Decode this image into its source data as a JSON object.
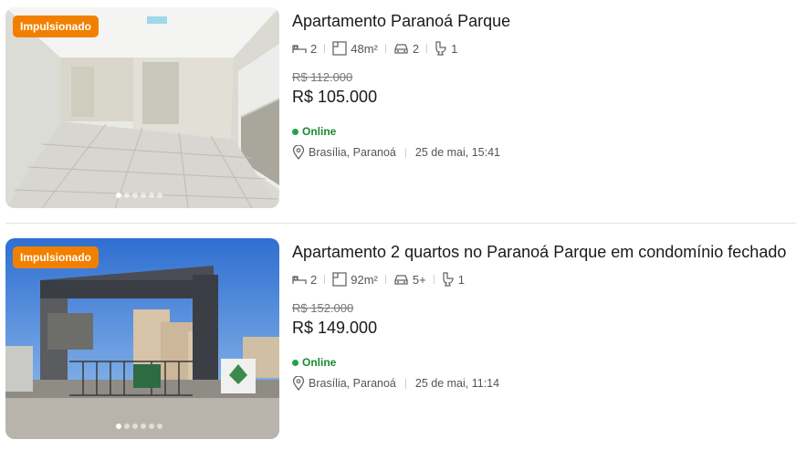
{
  "listings": [
    {
      "badge": "Impulsionado",
      "title": "Apartamento Paranoá Parque",
      "bedrooms": "2",
      "area": "48m²",
      "parking": "2",
      "bathrooms": "1",
      "old_price": "R$ 112.000",
      "price": "R$ 105.000",
      "status": "Online",
      "location": "Brasília, Paranoá",
      "date": "25 de mai, 15:41",
      "photo_count": 6,
      "icons": [
        "heart-icon",
        "bed-icon",
        "area-icon",
        "car-icon",
        "toilet-icon",
        "location-pin-icon"
      ]
    },
    {
      "badge": "Impulsionado",
      "title": "Apartamento 2 quartos no Paranoá Parque em condomínio fechado",
      "bedrooms": "2",
      "area": "92m²",
      "parking": "5+",
      "bathrooms": "1",
      "old_price": "R$ 152.000",
      "price": "R$ 149.000",
      "status": "Online",
      "location": "Brasília, Paranoá",
      "date": "25 de mai, 11:14",
      "photo_count": 6,
      "icons": [
        "heart-icon",
        "bed-icon",
        "area-icon",
        "car-icon",
        "toilet-icon",
        "location-pin-icon"
      ]
    }
  ],
  "colors": {
    "badge": "#f28000",
    "online": "#24a148",
    "divider": "#e3e3e3"
  }
}
